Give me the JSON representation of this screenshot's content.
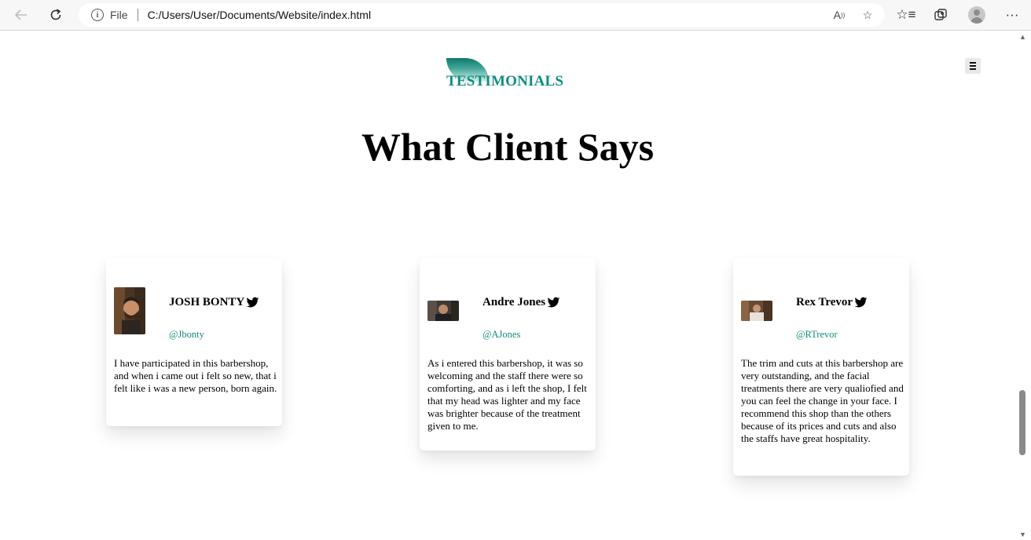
{
  "browser": {
    "address_label": "File",
    "url": "C:/Users/User/Documents/Website/index.html"
  },
  "header": {
    "brand": "TESTIMONIALS"
  },
  "main": {
    "title": "What Client Says",
    "testimonials": [
      {
        "name": "JOSH BONTY",
        "handle": "@Jbonty",
        "text": "I have participated in this barbershop, and when i came out i felt so new, that i felt like i was a new person, born again."
      },
      {
        "name": "Andre Jones",
        "handle": "@AJones",
        "text": "As i entered this barbershop, it was so welcoming and the staff there were so comforting, and as i left the shop, I felt that my head was lighter and my face was brighter because of the treatment given to me."
      },
      {
        "name": "Rex Trevor",
        "handle": "@RTrevor",
        "text": "The trim and cuts at this barbershop are very outstanding, and the facial treatments there are very qualiofied and you can feel the change in your face. I recommend this shop than the others because of its prices and cuts and also the staffs have great hospitality."
      }
    ]
  },
  "colors": {
    "accent": "#0f8d80",
    "handle": "#14897d"
  }
}
